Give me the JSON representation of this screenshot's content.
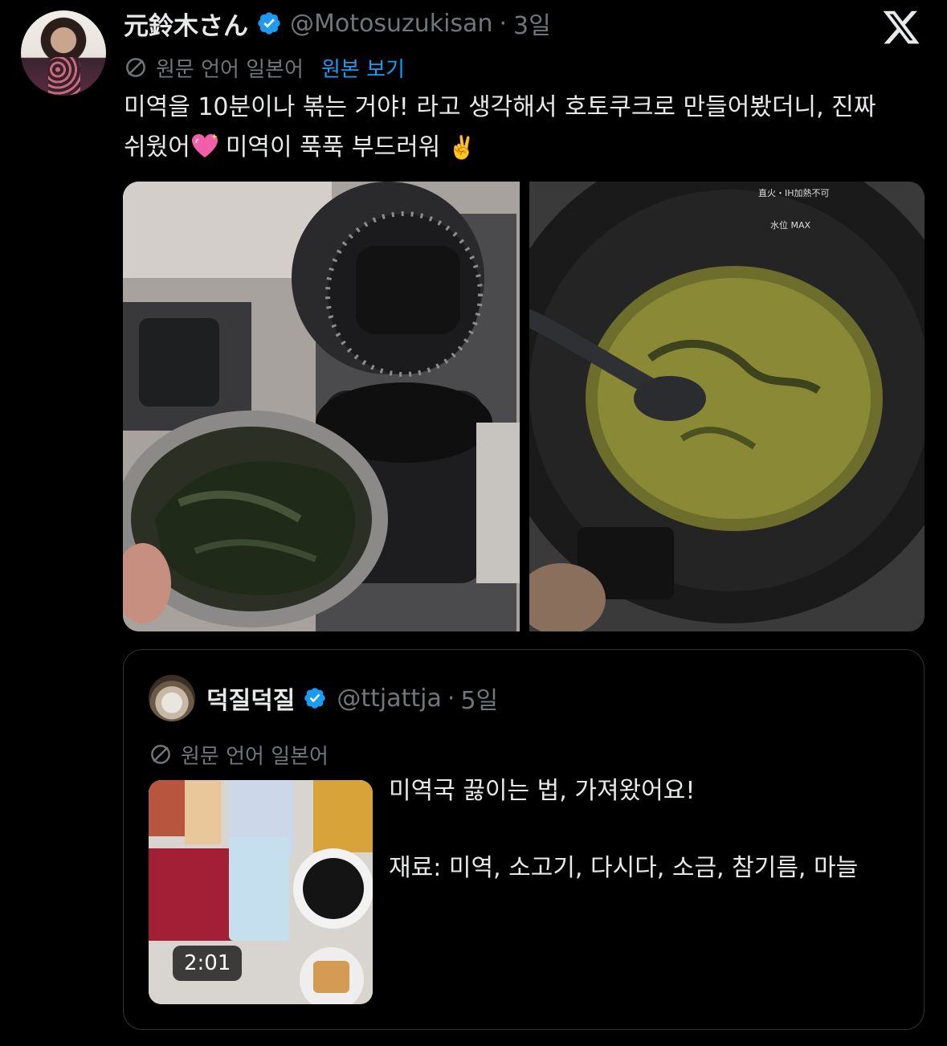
{
  "tweet": {
    "display_name": "元鈴木さん",
    "handle": "@Motosuzukisan",
    "separator": "·",
    "time": "3일",
    "translate_label": "원문 언어 일본어",
    "show_original": "원본 보기",
    "text_part1": "미역을 10분이나 볶는 거야! 라고 생각해서 호토쿠크로 만들어봤더니, 진짜 쉬웠어",
    "emoji_heart": "sparkling-heart-emoji",
    "text_part2": "미역이 푹푹 부드러워",
    "emoji_victory": "✌️"
  },
  "icons": {
    "verified": "verified-badge-icon",
    "translate": "translate-icon",
    "logo": "x-logo-icon"
  },
  "colors": {
    "background": "#000000",
    "text": "#e7e9ea",
    "secondary": "#71767b",
    "link": "#1d9bf0",
    "verified": "#1d9bf0",
    "border": "#2f3336"
  },
  "quote": {
    "display_name": "덕질덕질",
    "handle": "@ttjattja",
    "separator": "·",
    "time": "5일",
    "translate_label": "원문 언어 일본어",
    "video_duration": "2:01",
    "text": "미역국 끓이는 법, 가져왔어요!\n\n재료: 미역, 소고기, 다시다, 소금, 참기름, 마늘"
  }
}
